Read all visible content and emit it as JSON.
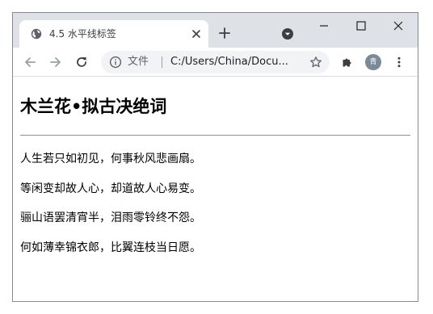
{
  "browser": {
    "tab": {
      "title": "4.5 水平线标签",
      "favicon": "globe-icon"
    },
    "controls": {
      "new_tab": "plus-icon",
      "tab_search": "chevron-down-circle-icon",
      "minimize": "minimize-icon",
      "maximize": "maximize-icon",
      "close": "close-icon"
    },
    "toolbar": {
      "back": "arrow-left-icon",
      "forward": "arrow-right-icon",
      "reload": "reload-icon",
      "extensions": "puzzle-icon",
      "menu": "more-vert-icon"
    },
    "omnibox": {
      "info_icon": "info-icon",
      "label": "文件",
      "url": "C:/Users/China/Docu...",
      "bookmark_icon": "star-icon"
    },
    "profile": {
      "initial": "青"
    },
    "colors": {
      "tabstrip": "#dee1e6",
      "omnibox": "#f1f3f4",
      "avatar": "#7b8a99"
    }
  },
  "page": {
    "heading": "木兰花•拟古决绝词",
    "lines": [
      "人生若只如初见，何事秋风悲画扇。",
      "等闲变却故人心，却道故人心易变。",
      "骊山语罢清宵半，泪雨零铃终不怨。",
      "何如薄幸锦衣郎，比翼连枝当日愿。"
    ]
  }
}
